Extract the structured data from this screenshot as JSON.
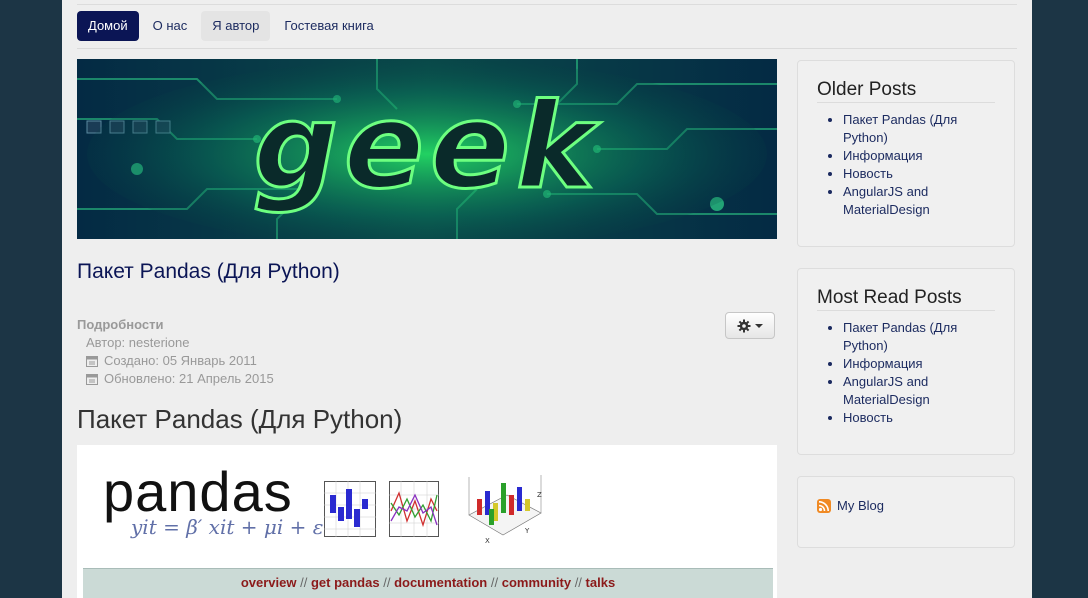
{
  "nav": {
    "items": [
      {
        "label": "Домой",
        "active": true
      },
      {
        "label": "О нас",
        "active": false
      },
      {
        "label": "Я автор",
        "active": false
      },
      {
        "label": "Гостевая книга",
        "active": false
      }
    ]
  },
  "banner": {
    "text": "geek"
  },
  "article": {
    "title": "Пакет Pandas (Для Python)",
    "details_label": "Подробности",
    "author": "Автор: nesterione",
    "created": "Создано: 05 Январь 2011",
    "updated": "Обновлено: 21 Апрель 2015",
    "heading": "Пакет Pandas (Для Python)"
  },
  "pandas_image": {
    "word": "pandas",
    "formula": "yit = β′ xit + μi + εit",
    "links": [
      "overview",
      "get pandas",
      "documentation",
      "community",
      "talks"
    ],
    "separator": "//"
  },
  "sidebar": {
    "older": {
      "title": "Older Posts",
      "items": [
        "Пакет Pandas (Для Python)",
        "Информация",
        "Новость",
        "AngularJS and MaterialDesign"
      ]
    },
    "most_read": {
      "title": "Most Read Posts",
      "items": [
        "Пакет Pandas (Для Python)",
        "Информация",
        "AngularJS and MaterialDesign",
        "Новость"
      ]
    },
    "blog": {
      "label": "My Blog"
    }
  },
  "colors": {
    "page_bg": "#1c3545",
    "content_bg": "#eeeeee",
    "nav_active": "#0b1555",
    "link": "#1b2a5f",
    "banner_green": "#4dff6a"
  },
  "icons": [
    "gear-icon",
    "calendar-icon",
    "rss-icon",
    "caret-down-icon"
  ]
}
